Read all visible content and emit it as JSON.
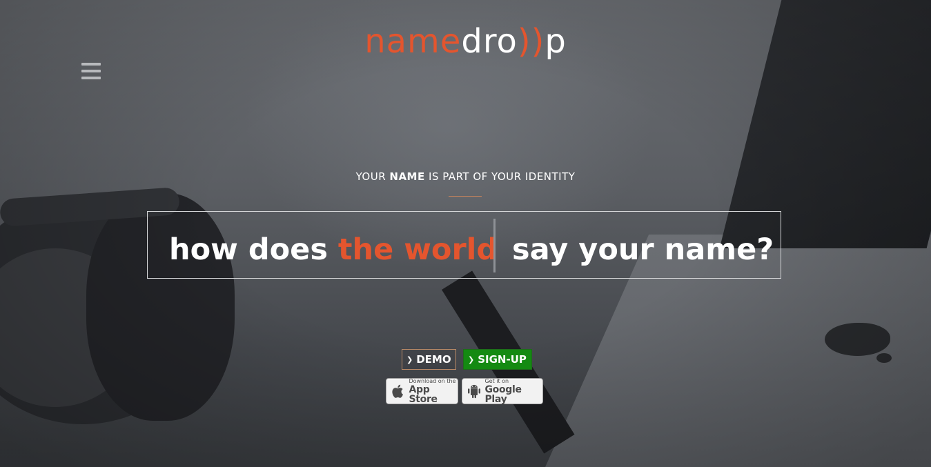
{
  "header": {
    "logo_part1": "name",
    "logo_part2": "dro",
    "logo_part3": "))",
    "logo_part4": "p",
    "menu_icon": "hamburger-menu-icon"
  },
  "hero": {
    "tagline_pre": "YOUR ",
    "tagline_bold": "NAME",
    "tagline_post": " IS PART OF YOUR IDENTITY",
    "headline_left_1": "how does ",
    "headline_left_accent": "the world",
    "headline_right": "say your name?"
  },
  "actions": {
    "demo_label": "DEMO",
    "signup_label": "SIGN-UP",
    "chevron_icon": "chevron-down-icon"
  },
  "stores": {
    "apple_small": "Download on the",
    "apple_big": "App Store",
    "google_small": "Get it on",
    "google_big": "Google Play"
  },
  "colors": {
    "accent": "#e4552e",
    "signup_bg": "#148a12",
    "text": "#ffffff"
  }
}
